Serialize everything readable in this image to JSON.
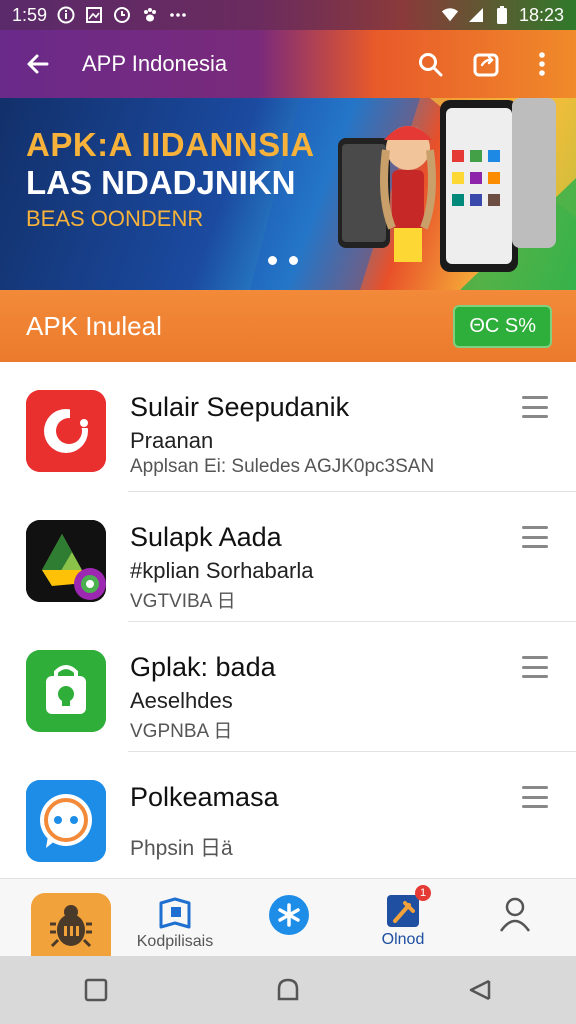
{
  "status_bar": {
    "time": "1:59",
    "right_time": "18:23"
  },
  "app_bar": {
    "title": "APP Indonesia"
  },
  "banner": {
    "line1": "APK:A IIDANNSIA",
    "line2": "LAS NDADJNIKN",
    "line3": "BEAS OONDENR"
  },
  "section": {
    "title": "APK Inuleal",
    "badge": "ΘC S%"
  },
  "apps": [
    {
      "name": "Sulair Seepudanik",
      "sub": "Praanan",
      "meta": "Applsan Ei: Suledes AGJK0pc3SAN",
      "icon": "red-refresh-icon",
      "color": "#ea2f2f"
    },
    {
      "name": "Sulapk Aada",
      "sub": "#kplian Sorhabarla",
      "meta": "VGTVIBA 日",
      "icon": "drive-like-icon",
      "color": "#111111"
    },
    {
      "name": "Gplak: bada",
      "sub": "Aeselhdes",
      "meta": "VGPNBA 日",
      "icon": "green-bag-icon",
      "color": "#2fae3a"
    },
    {
      "name": "Polkeamasa",
      "sub": "",
      "meta": "Phpsin 日ä",
      "icon": "blue-chat-icon",
      "color": "#1e8de8"
    }
  ],
  "bottom_nav": {
    "item1_label": "",
    "item2_label": "Kodpilisais",
    "item3_label": "",
    "item4_label": "Olnod",
    "item4_badge": "1",
    "item5_label": ""
  }
}
